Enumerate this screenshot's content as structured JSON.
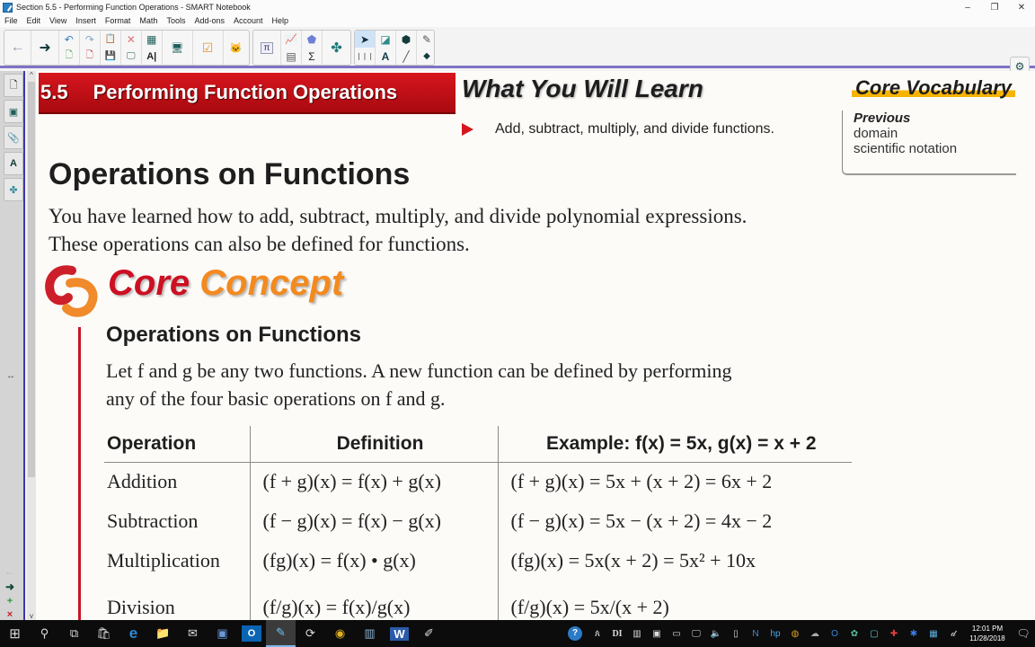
{
  "window": {
    "title": "Section 5.5 - Performing Function Operations - SMART Notebook",
    "controls": {
      "minimize": "–",
      "restore": "❐",
      "close": "✕"
    }
  },
  "menu": [
    "File",
    "Edit",
    "View",
    "Insert",
    "Format",
    "Math",
    "Tools",
    "Add-ons",
    "Account",
    "Help"
  ],
  "toolbar": {
    "back_icon": "←",
    "forward_icon": "➜",
    "undo_icon": "↶",
    "redo_icon": "↷",
    "paste_icon": "📋",
    "delete_icon": "✕",
    "table_icon": "▦",
    "add_page_icon": "🗋",
    "delete_page_icon": "🗋",
    "save_icon": "💾",
    "display_icon": "🖵",
    "text_icon": "A|",
    "screen_shade_icon": "🖥",
    "response_icon": "☑",
    "addon_icon": "🐱",
    "math_icon": "π",
    "graph_icon": "📈",
    "shape_recognition_icon": "⬟",
    "table_sum_icon": "▤",
    "sigma_icon": "Σ",
    "puzzle_icon": "✤",
    "select_icon": "➤",
    "shapes_icon": "◪",
    "fill_icon": "⬢",
    "pen_icon": "✎",
    "pens_icon": "❘❘❘",
    "text_tool_icon": "A",
    "line_icon": "╱",
    "eraser_icon": "◆",
    "settings_icon": "⚙",
    "move_toolbar_icon": "⇕"
  },
  "sidebar": {
    "tabs": [
      "page-sorter",
      "gallery",
      "attachments",
      "properties",
      "add-ons"
    ],
    "tab_glyphs": [
      "🗋",
      "▣",
      "📎",
      "A",
      "✤"
    ],
    "resize_glyph": "↔",
    "bottom": {
      "prev_page": "←",
      "next_page": "➜",
      "add_page": "+",
      "delete_page": "×"
    }
  },
  "scrollbar": {
    "up": "^",
    "down": "v"
  },
  "page": {
    "section_number": "5.5",
    "section_title": "Performing Function Operations",
    "learn_title": "What You Will Learn",
    "learn_items": [
      "Add, subtract, multiply, and divide functions."
    ],
    "vocab": {
      "title": "Core Vocabulary",
      "heading": "Previous",
      "items": [
        "domain",
        "scientific notation"
      ]
    },
    "heading": "Operations on Functions",
    "intro_lines": [
      "You have learned how to add, subtract, multiply, and divide polynomial expressions.",
      "These operations can also be defined for functions."
    ],
    "core_concept": {
      "word1": "Core",
      "word2": "Concept"
    },
    "concept_heading": "Operations on Functions",
    "concept_desc_lines": [
      "Let f and g be any two functions. A new function can be defined by performing",
      "any of the four basic operations on f and g."
    ],
    "table": {
      "headers": [
        "Operation",
        "Definition",
        "Example: f(x) = 5x, g(x) = x + 2"
      ],
      "rows": [
        [
          "Addition",
          "(f + g)(x) = f(x) + g(x)",
          "(f + g)(x) = 5x + (x + 2) = 6x + 2"
        ],
        [
          "Subtraction",
          "(f − g)(x) = f(x) − g(x)",
          "(f − g)(x) = 5x − (x + 2) = 4x − 2"
        ],
        [
          "Multiplication",
          "(fg)(x) = f(x) • g(x)",
          "(fg)(x) = 5x(x + 2) = 5x² + 10x"
        ],
        [
          "Division",
          "(f/g)(x) = f(x)/g(x)",
          "(f/g)(x) = 5x/(x + 2)"
        ]
      ]
    }
  },
  "taskbar": {
    "apps": [
      "start",
      "search",
      "task-view",
      "store",
      "edge",
      "file-explorer",
      "mail",
      "app",
      "outlook",
      "smart-notebook",
      "sync",
      "chrome",
      "app2",
      "word",
      "app3"
    ],
    "app_glyphs": [
      "⊞",
      "⚲",
      "⧉",
      "🛍",
      "e",
      "📁",
      "✉",
      "▣",
      "O",
      "✎",
      "⟳",
      "◉",
      "▥",
      "W",
      "✐"
    ],
    "tray_glyphs": [
      "?",
      "ጰ",
      "DI",
      "▥",
      "▣",
      "▭",
      "🖵",
      "🔈",
      "▯",
      "N",
      "hp",
      "◍",
      "☁",
      "O",
      "✿",
      "▢",
      "✚",
      "✱",
      "▦",
      "𝒹"
    ],
    "time": "12:01 PM",
    "date": "11/28/2018",
    "notifications_icon": "🗨"
  }
}
